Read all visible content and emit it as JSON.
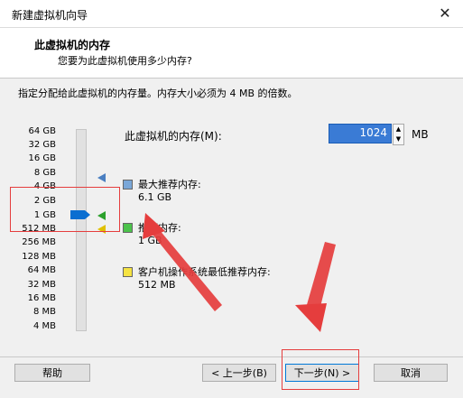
{
  "window": {
    "title": "新建虚拟机向导",
    "close_glyph": "✕"
  },
  "header": {
    "title": "此虚拟机的内存",
    "subtitle": "您要为此虚拟机使用多少内存?"
  },
  "description": "指定分配给此虚拟机的内存量。内存大小必须为 4 MB 的倍数。",
  "slider": {
    "ticks": [
      "64 GB",
      "32 GB",
      "16 GB",
      "8 GB",
      "4 GB",
      "2 GB",
      "1 GB",
      "512 MB",
      "256 MB",
      "128 MB",
      "64 MB",
      "32 MB",
      "16 MB",
      "8 MB",
      "4 MB"
    ],
    "selected": "1 GB"
  },
  "memory": {
    "label": "此虚拟机的内存(M):",
    "value": "1024",
    "unit": "MB"
  },
  "recommendations": [
    {
      "label": "最大推荐内存:",
      "value": "6.1 GB",
      "color": "#7aa7d8"
    },
    {
      "label": "推荐内存:",
      "value": "1 GB",
      "color": "#4cc34c"
    },
    {
      "label": "客户机操作系统最低推荐内存:",
      "value": "512 MB",
      "color": "#f5e342"
    }
  ],
  "buttons": {
    "help": "帮助",
    "back": "< 上一步(B)",
    "next": "下一步(N) >",
    "cancel": "取消"
  },
  "colors": {
    "annotation": "#e53d3d",
    "selection": "#0a6ed1"
  }
}
